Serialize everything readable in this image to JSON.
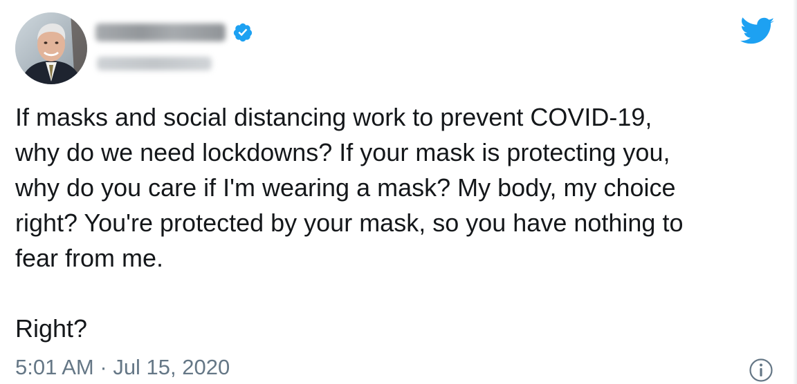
{
  "tweet": {
    "avatar_icon": "profile-photo",
    "verified_icon": "verified-badge-icon",
    "brand_icon": "twitter-bird-icon",
    "text": "If masks and social distancing work to prevent COVID-19,\nwhy do we need lockdowns? If your mask is protecting you,\nwhy do you care if I'm wearing a mask? My body, my choice\nright? You're protected by your mask, so you have nothing to\nfear from me.\n\nRight?",
    "time": "5:01 AM",
    "separator": " · ",
    "date": "Jul 15, 2020",
    "info_icon": "info-icon"
  },
  "colors": {
    "brand": "#1da1f2",
    "text": "#14171a",
    "meta": "#657786"
  }
}
